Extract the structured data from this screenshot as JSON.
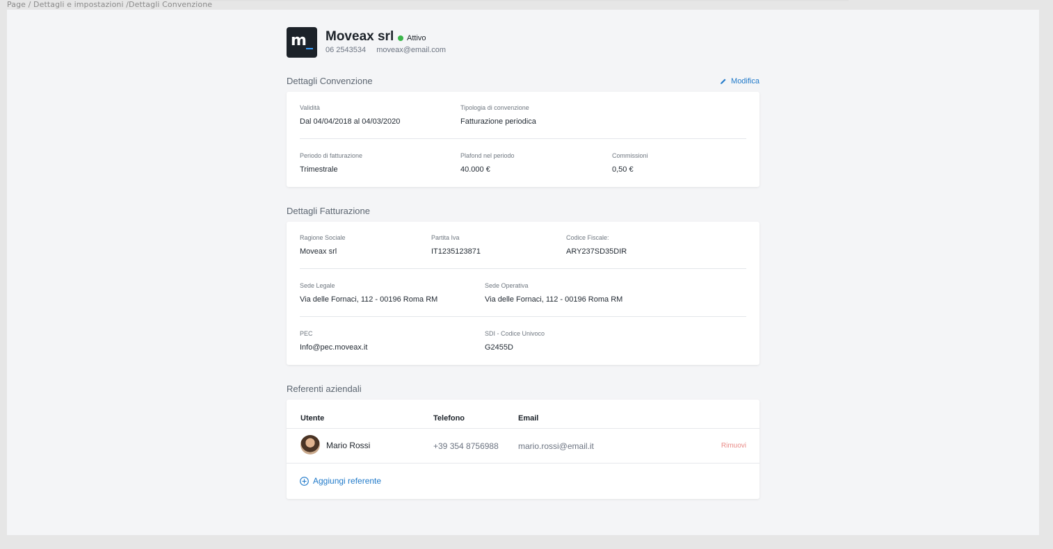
{
  "breadcrumb": "Page / Dettagli e impostazioni /Dettagli Convenzione",
  "company": {
    "logo_text": "m",
    "name": "Moveax srl",
    "status": "Attivo",
    "phone": "06 2543534",
    "email": "moveax@email.com"
  },
  "convenzione": {
    "title": "Dettagli Convenzione",
    "edit_label": "Modifica",
    "validita_label": "Validità",
    "validita_value": "Dal 04/04/2018 al 04/03/2020",
    "tipologia_label": "Tipologia di convenzione",
    "tipologia_value": "Fatturazione periodica",
    "periodo_label": "Periodo di fatturazione",
    "periodo_value": "Trimestrale",
    "plafond_label": "Plafond nel periodo",
    "plafond_value": "40.000 €",
    "commissioni_label": "Commissioni",
    "commissioni_value": "0,50 €"
  },
  "fatturazione": {
    "title": "Dettagli Fatturazione",
    "ragione_label": "Ragione Sociale",
    "ragione_value": "Moveax srl",
    "piva_label": "Partita Iva",
    "piva_value": "IT1235123871",
    "cf_label": "Codice Fiscale:",
    "cf_value": "ARY237SD35DIR",
    "legale_label": "Sede Legale",
    "legale_value": "Via delle Fornaci, 112 - 00196 Roma RM",
    "operativa_label": "Sede Operativa",
    "operativa_value": "Via delle Fornaci, 112 - 00196 Roma RM",
    "pec_label": "PEC",
    "pec_value": "Info@pec.moveax.it",
    "sdi_label": "SDI - Codice Univoco",
    "sdi_value": "G2455D"
  },
  "referenti": {
    "title": "Referenti aziendali",
    "headers": [
      "Utente",
      "Telefono",
      "Email"
    ],
    "rows": [
      {
        "name": "Mario Rossi",
        "phone": "+39 354 8756988",
        "email": "mario.rossi@email.it",
        "action": "Rimuovi"
      }
    ],
    "add_label": "Aggiungi referente"
  },
  "colors": {
    "accent": "#1f79c9",
    "status_active": "#3bb54a",
    "danger_text": "#e98a86",
    "logo_bg": "#1c2229"
  }
}
